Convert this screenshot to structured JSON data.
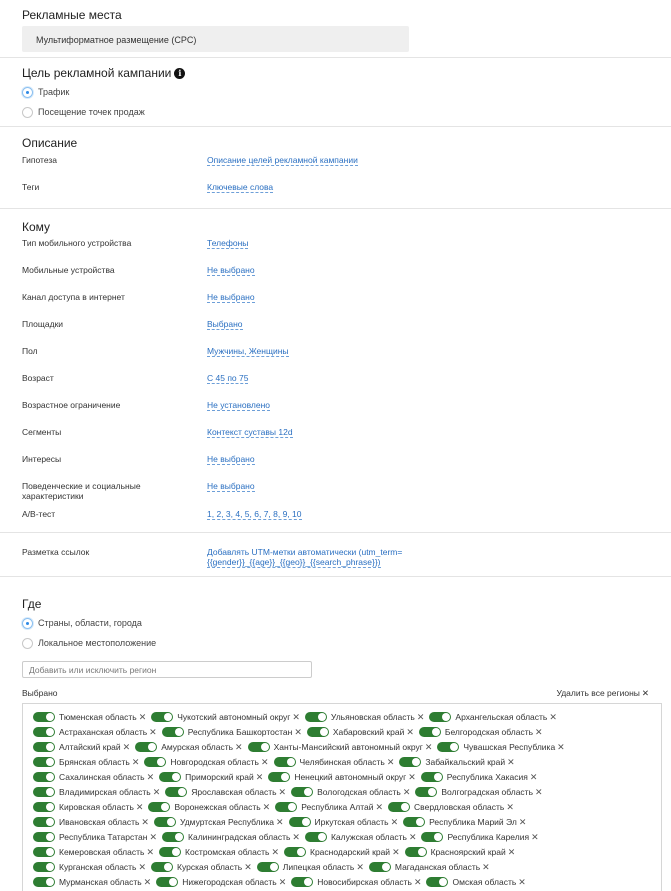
{
  "placements": {
    "title": "Рекламные места",
    "value": "Мультиформатное размещение (CPC)"
  },
  "goal": {
    "title": "Цель рекламной кампании",
    "options": [
      {
        "label": "Трафик",
        "selected": true
      },
      {
        "label": "Посещение точек продаж",
        "selected": false
      }
    ]
  },
  "description": {
    "title": "Описание",
    "rows": [
      {
        "label": "Гипотеза",
        "value": "Описание целей рекламной кампании"
      },
      {
        "label": "Теги",
        "value": "Ключевые слова"
      }
    ]
  },
  "audience": {
    "title": "Кому",
    "rows": [
      {
        "label": "Тип мобильного устройства",
        "value": "Телефоны"
      },
      {
        "label": "Мобильные устройства",
        "value": "Не выбрано"
      },
      {
        "label": "Канал доступа в интернет",
        "value": "Не выбрано"
      },
      {
        "label": "Площадки",
        "value": "Выбрано"
      },
      {
        "label": "Пол",
        "value": "Мужчины, Женщины"
      },
      {
        "label": "Возраст",
        "value": "С 45 по 75"
      },
      {
        "label": "Возрастное ограничение",
        "value": "Не установлено"
      },
      {
        "label": "Сегменты",
        "value": "Контекст суставы 12d"
      },
      {
        "label": "Интересы",
        "value": "Не выбрано"
      },
      {
        "label": "Поведенческие и социальные характеристики",
        "value": "Не выбрано"
      },
      {
        "label": "A/B-тест",
        "value": "1, 2, 3, 4, 5, 6, 7, 8, 9, 10"
      }
    ]
  },
  "links": {
    "label": "Разметка ссылок",
    "value_line1": "Добавлять UTM-метки автоматически (utm_term=",
    "value_line2": "{{gender}}_{{age}}_{{geo}}_{{search_phrase}})"
  },
  "where": {
    "title": "Где",
    "options": [
      {
        "label": "Страны, области, города",
        "selected": true
      },
      {
        "label": "Локальное местоположение",
        "selected": false
      }
    ],
    "search_placeholder": "Добавить или исключить регион",
    "selected_label": "Выбрано",
    "remove_all_label": "Удалить все регионы",
    "regions": [
      [
        "Тюменская область",
        "Чукотский автономный округ",
        "Ульяновская область",
        "Архангельская область"
      ],
      [
        "Астраханская область",
        "Республика Башкортостан",
        "Хабаровский край",
        "Белгородская область"
      ],
      [
        "Алтайский край",
        "Амурская область",
        "Ханты-Мансийский автономный округ",
        "Чувашская Республика"
      ],
      [
        "Брянская область",
        "Новгородская область",
        "Челябинская область",
        "Забайкальский край"
      ],
      [
        "Сахалинская область",
        "Приморский край",
        "Ненецкий автономный округ",
        "Республика Хакасия"
      ],
      [
        "Владимирская область",
        "Ярославская область",
        "Вологодская область",
        "Волгоградская область"
      ],
      [
        "Кировская область",
        "Воронежская область",
        "Республика Алтай",
        "Свердловская область"
      ],
      [
        "Ивановская область",
        "Удмуртская Республика",
        "Иркутская область",
        "Республика Марий Эл"
      ],
      [
        "Республика Татарстан",
        "Калининградская область",
        "Калужская область",
        "Республика Карелия"
      ],
      [
        "Кемеровская область",
        "Костромская область",
        "Краснодарский край",
        "Красноярский край"
      ],
      [
        "Курганская область",
        "Курская область",
        "Липецкая область",
        "Магаданская область"
      ],
      [
        "Мурманская область",
        "Нижегородская область",
        "Новосибирская область",
        "Омская область"
      ]
    ]
  }
}
